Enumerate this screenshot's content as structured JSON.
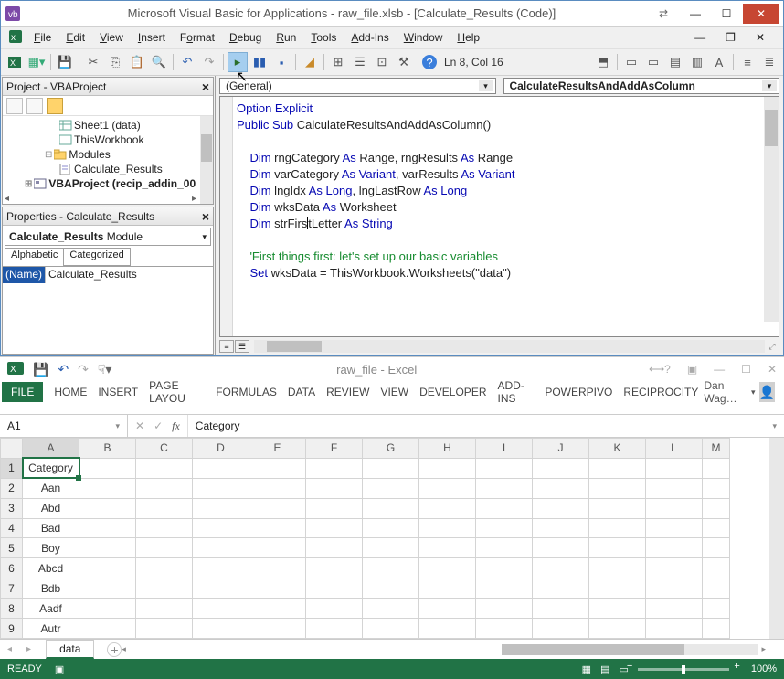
{
  "vba": {
    "title": "Microsoft Visual Basic for Applications - raw_file.xlsb - [Calculate_Results (Code)]",
    "menu": {
      "file": "File",
      "edit": "Edit",
      "view": "View",
      "insert": "Insert",
      "format": "Format",
      "debug": "Debug",
      "run": "Run",
      "tools": "Tools",
      "addins": "Add-Ins",
      "window": "Window",
      "help": "Help"
    },
    "toolbar_status": "Ln 8, Col 16",
    "project": {
      "title": "Project - VBAProject",
      "items": {
        "sheet1": "Sheet1 (data)",
        "thiswb": "ThisWorkbook",
        "modules": "Modules",
        "calcres": "Calculate_Results",
        "recip": "VBAProject (recip_addin_00"
      }
    },
    "properties": {
      "title": "Properties - Calculate_Results",
      "combo_name": "Calculate_Results",
      "combo_type": "Module",
      "tab_alpha": "Alphabetic",
      "tab_cat": "Categorized",
      "row_name": "(Name)",
      "row_val": "Calculate_Results"
    },
    "combos": {
      "left": "(General)",
      "right": "CalculateResultsAndAddAsColumn"
    },
    "code": {
      "l1_a": "Option Explicit",
      "l2_a": "Public Sub",
      "l2_b": " CalculateResultsAndAddAsColumn()",
      "l4_a": "Dim",
      "l4_b": " rngCategory ",
      "l4_c": "As",
      "l4_d": " Range, rngResults ",
      "l4_e": "As",
      "l4_f": " Range",
      "l5_a": "Dim",
      "l5_b": " varCategory ",
      "l5_c": "As Variant",
      "l5_d": ", varResults ",
      "l5_e": "As Variant",
      "l6_a": "Dim",
      "l6_b": " lngIdx ",
      "l6_c": "As Long",
      "l6_d": ", lngLastRow ",
      "l6_e": "As Long",
      "l7_a": "Dim",
      "l7_b": " wksData ",
      "l7_c": "As",
      "l7_d": " Worksheet",
      "l8_a": "Dim",
      "l8_b": " strFirs",
      "l8_c": "tLetter ",
      "l8_d": "As String",
      "l10": "'First things first: let's set up our basic variables",
      "l11_a": "Set",
      "l11_b": " wksData = ThisWorkbook.Worksheets(\"data\")"
    }
  },
  "excel": {
    "title": "raw_file - Excel",
    "tabs": {
      "file": "FILE",
      "home": "HOME",
      "insert": "INSERT",
      "pagelayout": "PAGE LAYOU",
      "formulas": "FORMULAS",
      "data": "DATA",
      "review": "REVIEW",
      "view": "VIEW",
      "developer": "DEVELOPER",
      "addins": "ADD-INS",
      "powerpivo": "POWERPIVO",
      "reciprocity": "RECIPROCITY"
    },
    "user": "Dan Wag…",
    "namebox": "A1",
    "formula": "Category",
    "columns": [
      "A",
      "B",
      "C",
      "D",
      "E",
      "F",
      "G",
      "H",
      "I",
      "J",
      "K",
      "L",
      "M"
    ],
    "rows": [
      {
        "n": "1",
        "v": "Category"
      },
      {
        "n": "2",
        "v": "Aan"
      },
      {
        "n": "3",
        "v": "Abd"
      },
      {
        "n": "4",
        "v": "Bad"
      },
      {
        "n": "5",
        "v": "Boy"
      },
      {
        "n": "6",
        "v": "Abcd"
      },
      {
        "n": "7",
        "v": "Bdb"
      },
      {
        "n": "8",
        "v": "Aadf"
      },
      {
        "n": "9",
        "v": "Autr"
      }
    ],
    "sheet_tab": "data",
    "status": "READY",
    "zoom": "100%"
  }
}
